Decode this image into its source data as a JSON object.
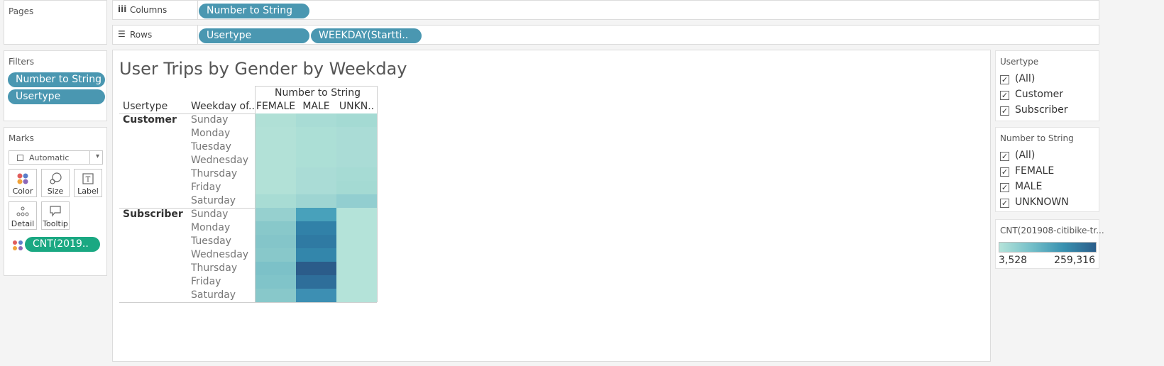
{
  "left_panel": {
    "pages_title": "Pages",
    "filters_title": "Filters",
    "filters": [
      "Number to String",
      "Usertype"
    ],
    "marks_title": "Marks",
    "mark_type": "Automatic",
    "mark_buttons": [
      {
        "label": "Color",
        "icon": "color-icon"
      },
      {
        "label": "Size",
        "icon": "size-icon"
      },
      {
        "label": "Label",
        "icon": "label-icon"
      },
      {
        "label": "Detail",
        "icon": "detail-icon"
      },
      {
        "label": "Tooltip",
        "icon": "tooltip-icon"
      }
    ],
    "color_pill": "CNT(2019.."
  },
  "shelves": {
    "columns_label": "Columns",
    "columns_pills": [
      "Number to String"
    ],
    "rows_label": "Rows",
    "rows_pills": [
      "Usertype",
      "WEEKDAY(Startti.."
    ]
  },
  "viz": {
    "title": "User Trips by Gender by Weekday",
    "column_group_header": "Number to String",
    "row_header_1": "Usertype",
    "row_header_2": "Weekday of..",
    "columns": [
      "FEMALE",
      "MALE",
      "UNKN.."
    ],
    "groups": [
      {
        "name": "Customer",
        "rows": [
          {
            "day": "Sunday",
            "colors": [
              "#b0e0d6",
              "#a8dcd5",
              "#a4dad3"
            ]
          },
          {
            "day": "Monday",
            "colors": [
              "#b2e1d7",
              "#acdfd6",
              "#aadcd6"
            ]
          },
          {
            "day": "Tuesday",
            "colors": [
              "#b2e1d7",
              "#acdfd6",
              "#aadcd6"
            ]
          },
          {
            "day": "Wednesday",
            "colors": [
              "#b2e1d7",
              "#acdfd6",
              "#aadcd6"
            ]
          },
          {
            "day": "Thursday",
            "colors": [
              "#b2e1d7",
              "#aadcd6",
              "#a6dbd4"
            ]
          },
          {
            "day": "Friday",
            "colors": [
              "#b2e1d7",
              "#aadcd6",
              "#a4dad3"
            ]
          },
          {
            "day": "Saturday",
            "colors": [
              "#a8dcd4",
              "#9ed5d2",
              "#92ced0"
            ]
          }
        ]
      },
      {
        "name": "Subscriber",
        "rows": [
          {
            "day": "Sunday",
            "colors": [
              "#96d0cf",
              "#48a1bb",
              "#b4e3d9"
            ]
          },
          {
            "day": "Monday",
            "colors": [
              "#88c8ca",
              "#3181a8",
              "#b4e3d9"
            ]
          },
          {
            "day": "Tuesday",
            "colors": [
              "#84c5c9",
              "#2f7aa3",
              "#b4e3d9"
            ]
          },
          {
            "day": "Wednesday",
            "colors": [
              "#88c8ca",
              "#3386ab",
              "#b4e3d9"
            ]
          },
          {
            "day": "Thursday",
            "colors": [
              "#7cc1c8",
              "#2b5c8a",
              "#b4e3d9"
            ]
          },
          {
            "day": "Friday",
            "colors": [
              "#80c4c9",
              "#2e6e9a",
              "#b4e3d9"
            ]
          },
          {
            "day": "Saturday",
            "colors": [
              "#88c8ca",
              "#3d8fb3",
              "#b4e3d9"
            ]
          }
        ]
      }
    ]
  },
  "right_panel": {
    "usertype_filter": {
      "title": "Usertype",
      "items": [
        "(All)",
        "Customer",
        "Subscriber"
      ]
    },
    "gender_filter": {
      "title": "Number to String",
      "items": [
        "(All)",
        "FEMALE",
        "MALE",
        "UNKNOWN"
      ]
    },
    "legend": {
      "title": "CNT(201908-citibike-tr...",
      "min": "3,528",
      "max": "259,316"
    }
  }
}
